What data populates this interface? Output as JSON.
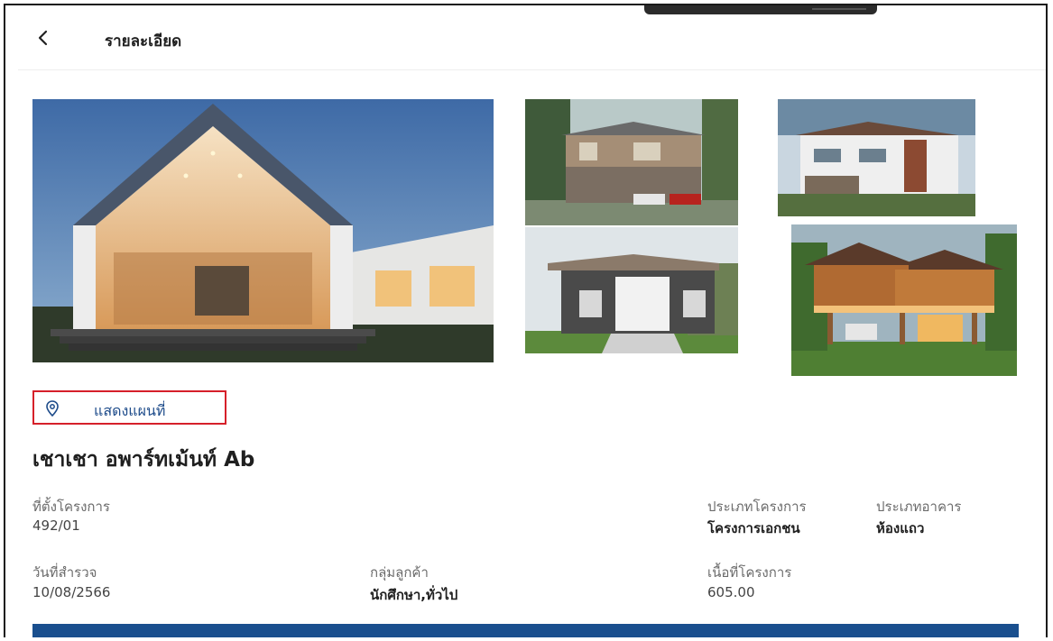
{
  "header": {
    "title": "รายละเอียด"
  },
  "gallery": {
    "images": [
      "house-main-photo",
      "house-photo-2",
      "house-photo-3",
      "house-photo-4",
      "house-photo-5"
    ]
  },
  "map_button": {
    "label": "แสดงแผนที่",
    "icon": "map-pin-icon"
  },
  "project": {
    "name": "เชาเชา อพาร์ทเม้นท์ Ab"
  },
  "details": {
    "location_label": "ที่ตั้งโครงการ",
    "location_value": "492/01",
    "project_type_label": "ประเภทโครงการ",
    "project_type_value": "โครงการเอกชน",
    "building_type_label": "ประเภทอาคาร",
    "building_type_value": "ห้องแถว",
    "survey_date_label": "วันที่สำรวจ",
    "survey_date_value": "10/08/2566",
    "customer_group_label": "กลุ่มลูกค้า",
    "customer_group_value": "นักศึกษา,ทั่วไป",
    "area_label": "เนื้อที่โครงการ",
    "area_value": "605.00"
  },
  "colors": {
    "accent": "#1a4f8e",
    "highlight_border": "#d6202a",
    "link": "#1d4b8a"
  }
}
